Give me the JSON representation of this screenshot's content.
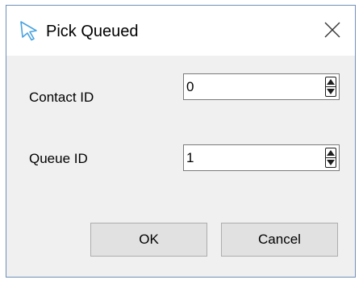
{
  "window": {
    "title": "Pick Queued",
    "icon": "cursor-arrow-icon",
    "close_icon": "close-icon"
  },
  "fields": {
    "contact": {
      "label": "Contact ID",
      "value": "0"
    },
    "queue": {
      "label": "Queue ID",
      "value": "1"
    }
  },
  "buttons": {
    "ok_label": "OK",
    "cancel_label": "Cancel"
  },
  "colors": {
    "accent": "#4aa3df",
    "window_border": "#6f8fb8",
    "dialog_background": "#f0f0f0",
    "button_background": "#e1e1e1"
  }
}
